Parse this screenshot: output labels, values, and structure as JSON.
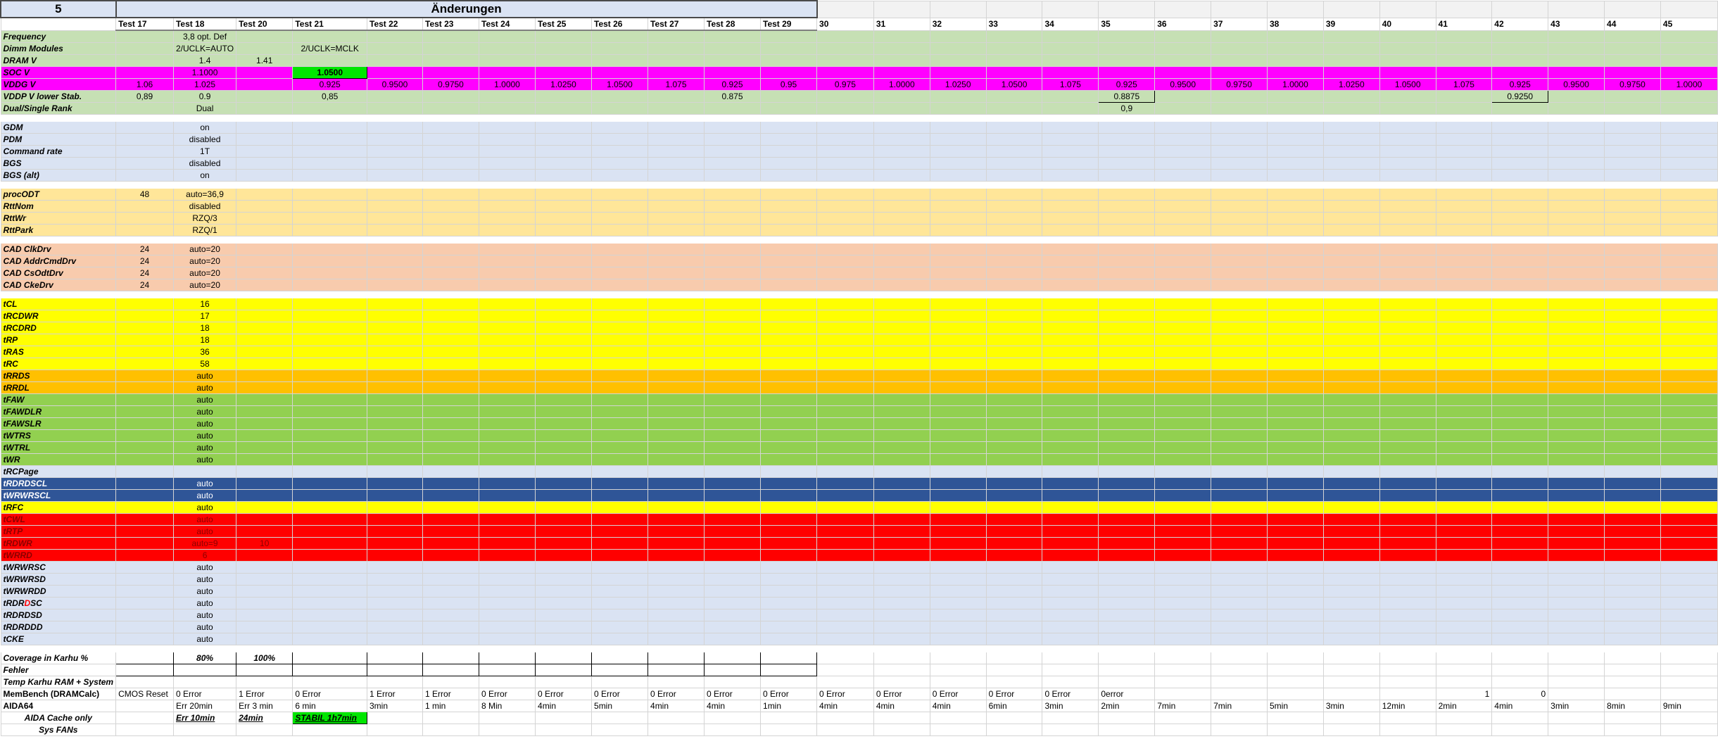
{
  "section_number": "5",
  "title": "Änderungen",
  "columns": [
    "Test 17",
    "Test 18",
    "Test 20",
    "Test 21",
    "Test 22",
    "Test 23",
    "Test 24",
    "Test 25",
    "Test 26",
    "Test 27",
    "Test 28",
    "Test 29",
    "30",
    "31",
    "32",
    "33",
    "34",
    "35",
    "36",
    "37",
    "38",
    "39",
    "40",
    "41",
    "42",
    "43",
    "44",
    "45"
  ],
  "colors": {
    "green_light": "#c6e0b4",
    "magenta": "#ff00ff",
    "blue_light": "#dae3f3",
    "peach": "#ffe699",
    "salmon": "#f8cbad",
    "yellow": "#ffff00",
    "orange": "#ffc000",
    "green": "#92d050",
    "navy": "#2f5597",
    "red": "#ff0000",
    "bright_green": "#00e600"
  },
  "groups": [
    {
      "rows": [
        {
          "label": "Frequency",
          "color": "green_light",
          "cells": {
            "1": "3,8 opt. Def"
          }
        },
        {
          "label": "Dimm Modules",
          "color": "green_light",
          "cells": {
            "1": "2/UCLK=AUTO",
            "3": "2/UCLK=MCLK"
          }
        },
        {
          "label": "DRAM V",
          "color": "green_light",
          "cells": {
            "1": "1.4",
            "2": "1.41"
          }
        },
        {
          "label": "SOC V",
          "color": "magenta",
          "cells": {
            "1": "1.1000",
            "3": "1.0500"
          },
          "highlight_col": "3"
        },
        {
          "label": "VDDG V",
          "color": "magenta",
          "cells": {
            "0": "1.06",
            "1": "1.025",
            "3": "0.925",
            "4": "0.9500",
            "5": "0.9750",
            "6": "1.0000",
            "7": "1.0250",
            "8": "1.0500",
            "9": "1.075",
            "10": "0.925",
            "11": "0.95",
            "12": "0.975",
            "13": "1.0000",
            "14": "1.0250",
            "15": "1.0500",
            "16": "1.075",
            "17": "0.925",
            "18": "0.9500",
            "19": "0.9750",
            "20": "1.0000",
            "21": "1.0250",
            "22": "1.0500",
            "23": "1.075",
            "24": "0.925",
            "25": "0.9500",
            "26": "0.9750",
            "27": "1.0000"
          }
        },
        {
          "label": "VDDP V lower Stab.",
          "color": "green_light",
          "cells": {
            "0": "0,89",
            "1": "0.9",
            "3": "0,85",
            "10": "0.875",
            "17": "0.8875",
            "24": "0.9250"
          }
        },
        {
          "label": "Dual/Single Rank",
          "color": "green_light",
          "cells": {
            "1": "Dual",
            "17": "0,9"
          }
        }
      ]
    },
    {
      "rows": [
        {
          "label": "GDM",
          "color": "blue_light",
          "cells": {
            "1": "on"
          }
        },
        {
          "label": "PDM",
          "color": "blue_light",
          "cells": {
            "1": "disabled"
          }
        },
        {
          "label": "Command rate",
          "color": "blue_light",
          "cells": {
            "1": "1T"
          }
        },
        {
          "label": "BGS",
          "color": "blue_light",
          "cells": {
            "1": "disabled"
          }
        },
        {
          "label": "BGS (alt)",
          "color": "blue_light",
          "cells": {
            "1": "on"
          }
        }
      ]
    },
    {
      "rows": [
        {
          "label": "procODT",
          "color": "peach",
          "cells": {
            "0": "48",
            "1": "auto=36,9"
          }
        },
        {
          "label": "RttNom",
          "color": "peach",
          "cells": {
            "1": "disabled"
          }
        },
        {
          "label": "RttWr",
          "color": "peach",
          "cells": {
            "1": "RZQ/3"
          }
        },
        {
          "label": "RttPark",
          "color": "peach",
          "cells": {
            "1": "RZQ/1"
          }
        }
      ]
    },
    {
      "rows": [
        {
          "label": "CAD ClkDrv",
          "color": "salmon",
          "cells": {
            "0": "24",
            "1": "auto=20"
          }
        },
        {
          "label": "CAD AddrCmdDrv",
          "color": "salmon",
          "cells": {
            "0": "24",
            "1": "auto=20"
          }
        },
        {
          "label": "CAD CsOdtDrv",
          "color": "salmon",
          "cells": {
            "0": "24",
            "1": "auto=20"
          }
        },
        {
          "label": "CAD CkeDrv",
          "color": "salmon",
          "cells": {
            "0": "24",
            "1": "auto=20"
          }
        }
      ]
    },
    {
      "rows": [
        {
          "label": "tCL",
          "color": "yellow",
          "cells": {
            "1": "16"
          }
        },
        {
          "label": "tRCDWR",
          "color": "yellow",
          "cells": {
            "1": "17"
          }
        },
        {
          "label": "tRCDRD",
          "color": "yellow",
          "cells": {
            "1": "18"
          }
        },
        {
          "label": "tRP",
          "color": "yellow",
          "cells": {
            "1": "18"
          }
        },
        {
          "label": "tRAS",
          "color": "yellow",
          "cells": {
            "1": "36"
          }
        },
        {
          "label": "tRC",
          "color": "yellow",
          "cells": {
            "1": "58"
          }
        },
        {
          "label": "tRRDS",
          "color": "orange",
          "cells": {
            "1": "auto"
          }
        },
        {
          "label": "tRRDL",
          "color": "orange",
          "cells": {
            "1": "auto"
          }
        },
        {
          "label": "tFAW",
          "color": "green",
          "cells": {
            "1": "auto"
          }
        },
        {
          "label": "tFAWDLR",
          "color": "green",
          "cells": {
            "1": "auto"
          }
        },
        {
          "label": "tFAWSLR",
          "color": "green",
          "cells": {
            "1": "auto"
          }
        },
        {
          "label": "tWTRS",
          "color": "green",
          "cells": {
            "1": "auto"
          }
        },
        {
          "label": "tWTRL",
          "color": "green",
          "cells": {
            "1": "auto"
          }
        },
        {
          "label": "tWR",
          "color": "green",
          "cells": {
            "1": "auto"
          }
        },
        {
          "label": "tRCPage",
          "color": "blue_light",
          "cells": {}
        },
        {
          "label": "tRDRDSCL",
          "color": "navy",
          "cells": {
            "1": "auto"
          }
        },
        {
          "label": "tWRWRSCL",
          "color": "navy",
          "cells": {
            "1": "auto"
          }
        },
        {
          "label": "tRFC",
          "color": "yellow",
          "cells": {
            "1": "auto"
          }
        },
        {
          "label": "tCWL",
          "color": "red",
          "cells": {
            "1": "auto"
          }
        },
        {
          "label": "tRTP",
          "color": "red",
          "cells": {
            "1": "auto"
          }
        },
        {
          "label": "tRDWR",
          "color": "red",
          "cells": {
            "1": "auto=9",
            "2": "10"
          }
        },
        {
          "label": "tWRRD",
          "color": "red",
          "cells": {
            "1": "6"
          }
        },
        {
          "label": "tWRWRSC",
          "color": "blue_light",
          "cells": {
            "1": "auto"
          }
        },
        {
          "label": "tWRWRSD",
          "color": "blue_light",
          "cells": {
            "1": "auto"
          }
        },
        {
          "label": "tWRWRDD",
          "color": "blue_light",
          "cells": {
            "1": "auto"
          }
        },
        {
          "label": "tRDRDSC",
          "color": "blue_light",
          "cells": {
            "1": "auto"
          }
        },
        {
          "label": "tRDRDSD",
          "color": "blue_light",
          "cells": {
            "1": "auto"
          }
        },
        {
          "label": "tRDRDDD",
          "color": "blue_light",
          "cells": {
            "1": "auto"
          }
        },
        {
          "label": "tCKE",
          "color": "blue_light",
          "cells": {
            "1": "auto"
          }
        }
      ]
    }
  ],
  "results": {
    "coverage": {
      "label": "Coverage in Karhu %",
      "cells": {
        "1": "80%",
        "2": "100%"
      }
    },
    "errors_label": "Fehler",
    "temp_label": "Temp Karhu RAM + System",
    "membench": {
      "label": "MemBench (DRAMCalc)",
      "cells": {
        "0": "CMOS Reset",
        "1": "0 Error",
        "2": "1 Error",
        "3": "0 Error",
        "4": "1 Error",
        "5": "1 Error",
        "6": "0 Error",
        "7": "0 Error",
        "8": "0 Error",
        "9": "0 Error",
        "10": "0 Error",
        "11": "0 Error",
        "12": "0 Error",
        "13": "0 Error",
        "14": "0 Error",
        "15": "0 Error",
        "16": "0 Error",
        "17": "0error",
        "23": "1",
        "24": "0"
      }
    },
    "aida64": {
      "label": "AIDA64",
      "cells": {
        "1": "Err 20min",
        "2": "Err 3 min",
        "3": "6 min",
        "4": "3min",
        "5": "1 min",
        "6": "8 Min",
        "7": "4min",
        "8": "5min",
        "9": "4min",
        "10": "4min",
        "11": "1min",
        "12": "4min",
        "13": "4min",
        "14": "4min",
        "15": "6min",
        "16": "3min",
        "17": "2min",
        "18": "7min",
        "19": "7min",
        "20": "5min",
        "21": "3min",
        "22": "12min",
        "23": "2min",
        "24": "4min",
        "25": "3min",
        "26": "8min",
        "27": "9min"
      }
    },
    "aida_cache": {
      "label": "AIDA Cache only",
      "cells": {
        "1": "Err 10min",
        "2": "24min",
        "3": "STABIL 1h7min"
      }
    },
    "sys_fans_label": "Sys FANs"
  }
}
